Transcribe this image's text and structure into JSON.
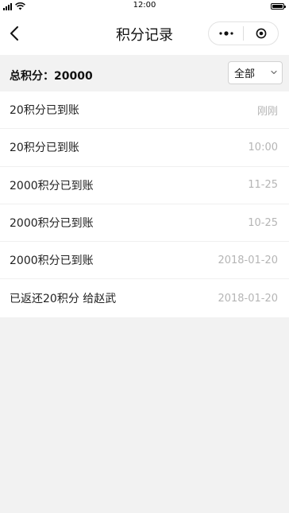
{
  "status_bar": {
    "time": "12:00"
  },
  "nav": {
    "title": "积分记录"
  },
  "summary": {
    "total_label": "总积分：20000"
  },
  "filter": {
    "selected": "全部"
  },
  "records": [
    {
      "text": "20积分已到账",
      "time": "刚刚"
    },
    {
      "text": "20积分已到账",
      "time": "10:00"
    },
    {
      "text": "2000积分已到账",
      "time": "11-25"
    },
    {
      "text": "2000积分已到账",
      "time": "10-25"
    },
    {
      "text": "2000积分已到账",
      "time": "2018-01-20"
    },
    {
      "text": "已返还20积分 给赵武",
      "time": "2018-01-20"
    }
  ],
  "icons": {
    "signal": "signal-icon",
    "wifi": "wifi-icon",
    "battery": "battery-icon",
    "back": "chevron-left-icon",
    "more": "more-dots-icon",
    "close": "target-circle-icon",
    "dropdown": "chevron-down-icon"
  }
}
